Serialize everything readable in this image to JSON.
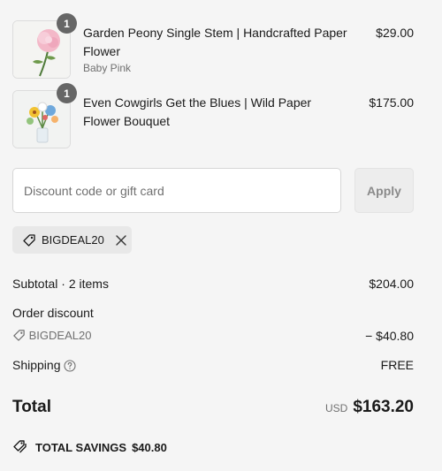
{
  "cart": {
    "items": [
      {
        "quantity": "1",
        "title": "Garden Peony Single Stem | Handcrafted Paper Flower",
        "variant": "Baby Pink",
        "price": "$29.00"
      },
      {
        "quantity": "1",
        "title": "Even Cowgirls Get the Blues | Wild Paper Flower Bouquet",
        "variant": "",
        "price": "$175.00"
      }
    ]
  },
  "discount": {
    "placeholder": "Discount code or gift card",
    "value": "",
    "apply_label": "Apply",
    "applied_code": "BIGDEAL20"
  },
  "summary": {
    "subtotal_label": "Subtotal · 2 items",
    "subtotal_value": "$204.00",
    "order_discount_label": "Order discount",
    "discount_code": "BIGDEAL20",
    "discount_value": "− $40.80",
    "shipping_label": "Shipping",
    "shipping_value": "FREE",
    "total_label": "Total",
    "currency": "USD",
    "total_value": "$163.20",
    "savings_label": "TOTAL SAVINGS",
    "savings_value": "$40.80"
  },
  "colors": {
    "background": "#f5f5f5",
    "badge": "#666666",
    "muted_text": "#707070"
  },
  "icons": {
    "chip": "tag-icon",
    "remove": "close-icon",
    "shipping_help": "question-circle-icon",
    "savings": "tags-icon"
  }
}
